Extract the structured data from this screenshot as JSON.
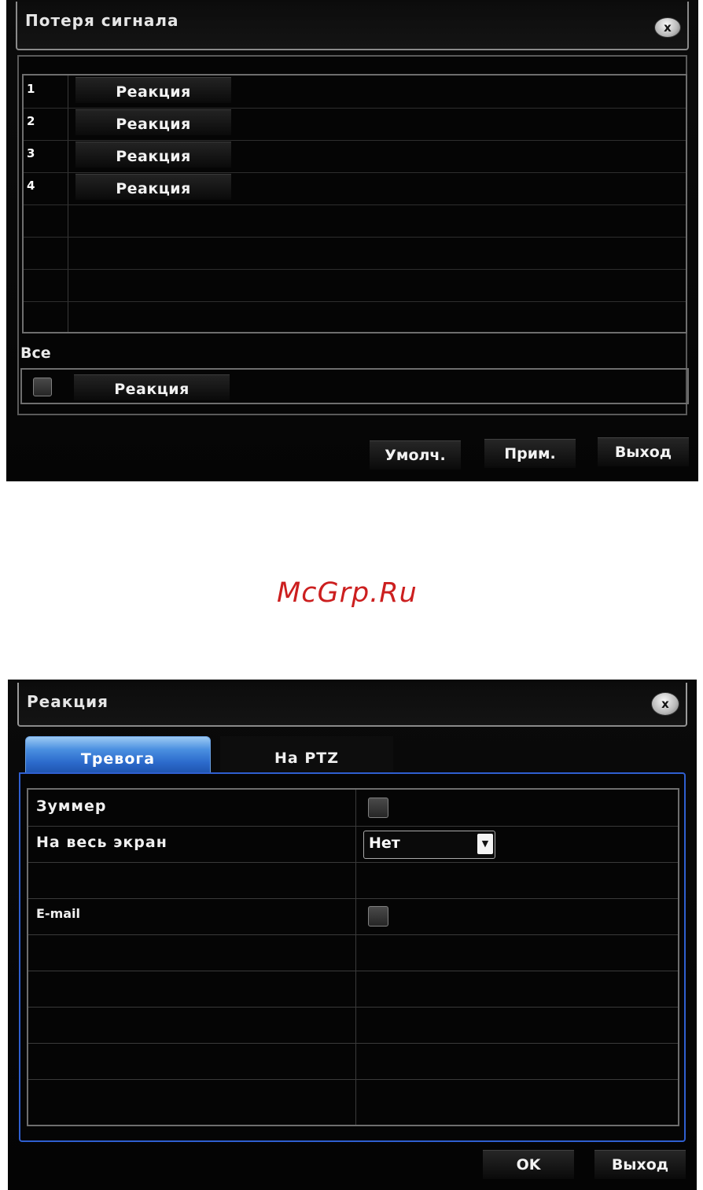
{
  "signal_loss_dialog": {
    "title": "Потеря сигнала",
    "close_icon": "x",
    "channels": [
      {
        "number": "1",
        "action_label": "Реакция"
      },
      {
        "number": "2",
        "action_label": "Реакция"
      },
      {
        "number": "3",
        "action_label": "Реакция"
      },
      {
        "number": "4",
        "action_label": "Реакция"
      }
    ],
    "all_label": "Все",
    "all_action_label": "Реакция",
    "all_checked": false,
    "buttons": {
      "default": "Умолч.",
      "apply": "Прим.",
      "exit": "Выход"
    }
  },
  "watermark": "McGrp.Ru",
  "reaction_dialog": {
    "title": "Реакция",
    "close_icon": "x",
    "tabs": [
      {
        "label": "Тревога",
        "active": true
      },
      {
        "label": "На PTZ",
        "active": false
      }
    ],
    "rows": {
      "buzzer_label": "Зуммер",
      "buzzer_checked": false,
      "fullscreen_label": "На весь экран",
      "fullscreen_value": "Нет",
      "email_label": "E-mail",
      "email_checked": false
    },
    "buttons": {
      "ok": "OK",
      "exit": "Выход"
    }
  },
  "colors": {
    "background": "#050505",
    "text": "#f0f0f0",
    "active_tab": "#2c6bcc",
    "panel_border_blue": "#2f5fd0",
    "watermark": "#cc1f1f"
  }
}
